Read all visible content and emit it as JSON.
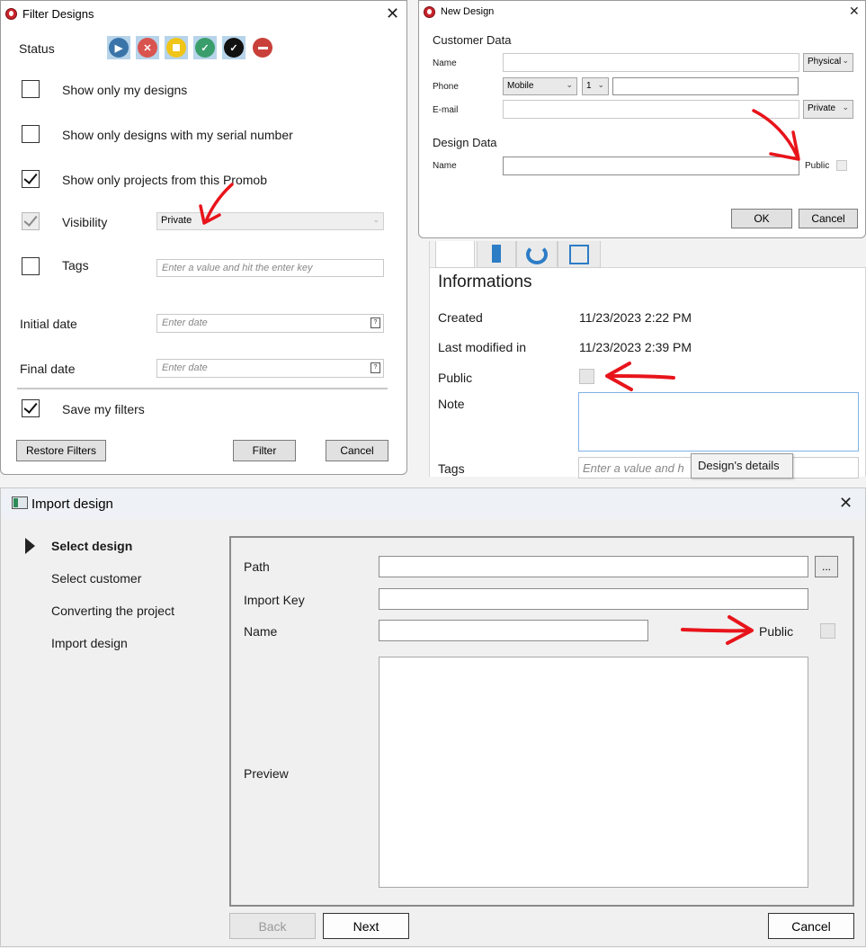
{
  "filter_dialog": {
    "title": "Filter Designs",
    "status_label": "Status",
    "opt_my_designs": "Show only my designs",
    "opt_serial": "Show only designs with my serial number",
    "opt_projects": "Show only projects from this Promob",
    "visibility_label": "Visibility",
    "visibility_value": "Private",
    "tags_label": "Tags",
    "tags_placeholder": "Enter a value and hit the enter key",
    "initial_date_label": "Initial date",
    "initial_date_placeholder": "Enter date",
    "final_date_label": "Final date",
    "final_date_placeholder": "Enter date",
    "save_filters": "Save my filters",
    "restore_button": "Restore Filters",
    "filter_button": "Filter",
    "cancel_button": "Cancel",
    "calendar_glyph": "?"
  },
  "new_design_dialog": {
    "title": "New Design",
    "customer_section": "Customer Data",
    "name_label": "Name",
    "name_type": "Physical",
    "phone_label": "Phone",
    "phone_type": "Mobile",
    "phone_ext": "1",
    "email_label": "E-mail",
    "email_type": "Private",
    "design_section": "Design Data",
    "design_name_label": "Name",
    "public_label": "Public",
    "ok_button": "OK",
    "cancel_button": "Cancel"
  },
  "info_panel": {
    "heading": "Informations",
    "created_label": "Created",
    "created_value": "11/23/2023 2:22 PM",
    "modified_label": "Last modified in",
    "modified_value": "11/23/2023 2:39 PM",
    "public_label": "Public",
    "note_label": "Note",
    "tags_label": "Tags",
    "tags_placeholder": "Enter a value and h",
    "tooltip": "Design's details"
  },
  "import_dialog": {
    "title": "Import design",
    "steps": [
      "Select design",
      "Select customer",
      "Converting the project",
      "Import design"
    ],
    "path_label": "Path",
    "browse_button": "...",
    "import_key_label": "Import Key",
    "name_label": "Name",
    "public_label": "Public",
    "preview_label": "Preview",
    "back_button": "Back",
    "next_button": "Next",
    "cancel_button": "Cancel"
  },
  "colors": {
    "annotation_arrow": "#e8141b",
    "app_logo": "#c8242b",
    "status_play": "#3b74a8",
    "status_cancel": "#d9534f",
    "status_pause": "#f0c419",
    "status_done": "#3a9e6c",
    "status_all": "#111111",
    "status_delete": "#c9403a"
  }
}
